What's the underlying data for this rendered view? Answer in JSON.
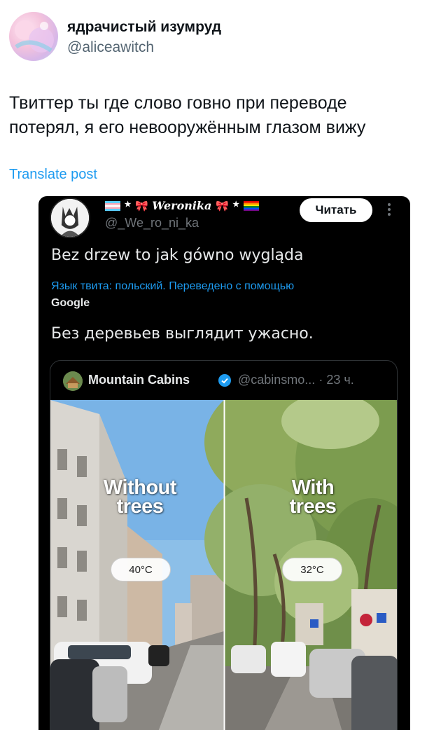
{
  "outer_tweet": {
    "author_name": "ядрачистый изумруд",
    "author_handle": "@aliceawitch",
    "text_line1": "Твиттер ты где слово говно при переводе",
    "text_line2": "потерял, я его невооружённым глазом вижу",
    "translate_label": "Translate post"
  },
  "embedded_tweet": {
    "author_name_text": "Weronika",
    "author_handle": "@_We_ro_ni_ka",
    "read_button": "Читать",
    "text": "Bez drzew to jak gówno wygląda",
    "translation_notice": "Язык твита: польский. Переведено с помощью",
    "translation_provider": "Google",
    "translated_text": "Без деревьев выглядит ужасно.",
    "quoted": {
      "name": "Mountain Cabins",
      "handle": "@cabinsmo...",
      "time": "· 23 ч.",
      "left_label_line1": "Without",
      "left_label_line2": "trees",
      "right_label_line1": "With",
      "right_label_line2": "trees",
      "left_temp": "40°C",
      "right_temp": "32°C"
    }
  },
  "colors": {
    "link_blue": "#1d9bf0",
    "muted_gray": "#536471",
    "dark_bg": "#000000"
  },
  "icons": [
    "more-icon",
    "verified-icon"
  ]
}
